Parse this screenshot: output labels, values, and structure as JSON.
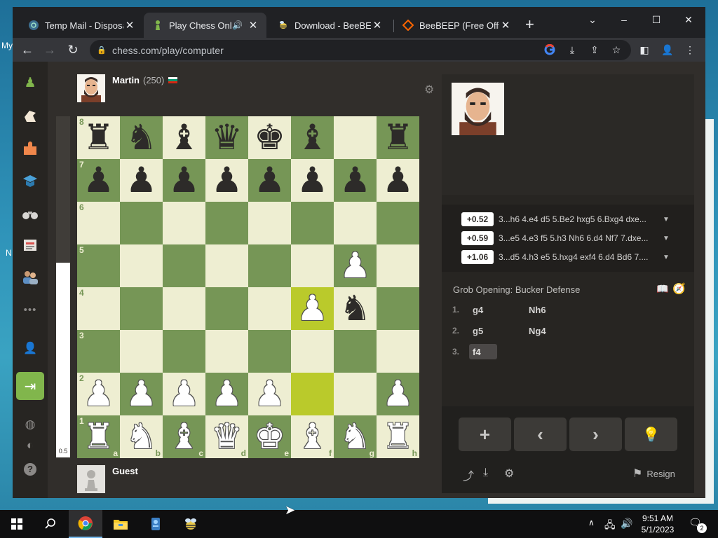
{
  "browser": {
    "tabs": [
      {
        "label": "Temp Mail - Disposab",
        "icon": "tempmail-favicon",
        "active": false
      },
      {
        "label": "Play Chess Online",
        "icon": "chess-pawn-favicon",
        "active": true,
        "audio": true
      },
      {
        "label": "Download - BeeBEEP",
        "icon": "beebeep-favicon",
        "active": false
      },
      {
        "label": "BeeBEEP (Free Office",
        "icon": "sourceforge-favicon",
        "active": false
      }
    ],
    "close_glyph": "✕",
    "new_tab": "+",
    "url": "chess.com/play/computer",
    "window_controls": {
      "tabsearch": "⌄",
      "minimize": "–",
      "maximize": "☐",
      "close": "✕"
    }
  },
  "desktop": {
    "left_text_1": "My",
    "left_text_2": "N"
  },
  "sidebar": {
    "icons": [
      "chess-logo-icon",
      "play-icon",
      "puzzles-icon",
      "learn-icon",
      "watch-icon",
      "news-icon",
      "social-icon",
      "more-icon",
      "add-friend-icon",
      "login-icon",
      "language-icon",
      "theme-icon",
      "help-icon"
    ]
  },
  "game": {
    "opponent": {
      "name": "Martin",
      "rating": "(250)",
      "flag": "Bulgaria"
    },
    "player": {
      "name": "Guest"
    },
    "eval_value": "0.5",
    "eval_white_fraction": 0.57,
    "board": [
      [
        "r",
        "n",
        "b",
        "q",
        "k",
        "b",
        "",
        "r"
      ],
      [
        "p",
        "p",
        "p",
        "p",
        "p",
        "p",
        "p",
        "p"
      ],
      [
        "",
        "",
        "",
        "",
        "",
        "",
        "",
        ""
      ],
      [
        "",
        "",
        "",
        "",
        "",
        "",
        "P",
        ""
      ],
      [
        "",
        "",
        "",
        "",
        "",
        "P",
        "n",
        ""
      ],
      [
        "",
        "",
        "",
        "",
        "",
        "",
        "",
        ""
      ],
      [
        "P",
        "P",
        "P",
        "P",
        "P",
        "",
        "",
        "P"
      ],
      [
        "R",
        "N",
        "B",
        "Q",
        "K",
        "B",
        "N",
        "R"
      ]
    ],
    "highlight": [
      "f4",
      "f2"
    ],
    "ranks": [
      "8",
      "7",
      "6",
      "5",
      "4",
      "3",
      "2",
      "1"
    ],
    "files": [
      "a",
      "b",
      "c",
      "d",
      "e",
      "f",
      "g",
      "h"
    ]
  },
  "panel": {
    "engine_lines": [
      {
        "score": "+0.52",
        "moves": "3...h6 4.e4 d5 5.Be2 hxg5 6.Bxg4 dxe..."
      },
      {
        "score": "+0.59",
        "moves": "3...e5 4.e3 f5 5.h3 Nh6 6.d4 Nf7 7.dxe..."
      },
      {
        "score": "+1.06",
        "moves": "3...d5 4.h3 e5 5.hxg4 exf4 6.d4 Bd6 7...."
      }
    ],
    "opening": "Grob Opening: Bucker Defense",
    "moves": [
      {
        "num": "1.",
        "white": "g4",
        "black": "Nh6"
      },
      {
        "num": "2.",
        "white": "g5",
        "black": "Ng4"
      },
      {
        "num": "3.",
        "white": "f4",
        "black": ""
      }
    ],
    "controls": {
      "new": "+",
      "back": "‹",
      "forward": "›",
      "hint": "💡"
    },
    "resign_label": "Resign"
  },
  "taskbar": {
    "time": "9:51 AM",
    "date": "5/1/2023",
    "notifications": "2"
  }
}
